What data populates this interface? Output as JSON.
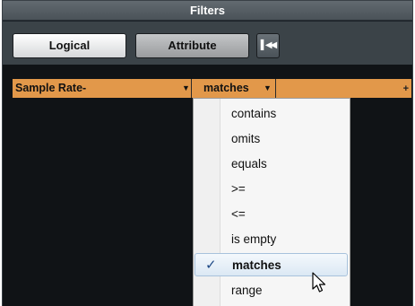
{
  "window": {
    "title": "Filters"
  },
  "toolbar": {
    "logical_label": "Logical",
    "attribute_label": "Attribute",
    "first_icon": "skip-to-start-icon"
  },
  "filter_row": {
    "parameter": "Sample Rate-",
    "condition": "matches",
    "value": ""
  },
  "dropdown": {
    "items": [
      {
        "label": "contains",
        "selected": false
      },
      {
        "label": "omits",
        "selected": false
      },
      {
        "label": "equals",
        "selected": false
      },
      {
        "label": ">=",
        "selected": false
      },
      {
        "label": "<=",
        "selected": false
      },
      {
        "label": "is empty",
        "selected": false
      },
      {
        "label": "matches",
        "selected": true
      },
      {
        "label": "range",
        "selected": false
      }
    ]
  },
  "colors": {
    "filter_row": "#e2984a",
    "background": "#101316",
    "check": "#1f4a86"
  }
}
